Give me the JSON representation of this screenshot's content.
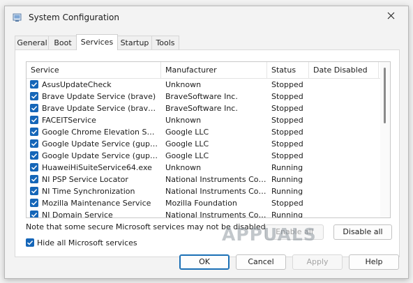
{
  "window": {
    "title": "System Configuration",
    "app_icon": "msconfig-icon",
    "close_icon": "close-icon"
  },
  "tabs": [
    {
      "label": "General",
      "active": false
    },
    {
      "label": "Boot",
      "active": false
    },
    {
      "label": "Services",
      "active": true
    },
    {
      "label": "Startup",
      "active": false
    },
    {
      "label": "Tools",
      "active": false
    }
  ],
  "services_table": {
    "columns": [
      "Service",
      "Manufacturer",
      "Status",
      "Date Disabled"
    ],
    "rows": [
      {
        "checked": true,
        "service": "AsusUpdateCheck",
        "manufacturer": "Unknown",
        "status": "Stopped",
        "date_disabled": ""
      },
      {
        "checked": true,
        "service": "Brave Update Service (brave)",
        "manufacturer": "BraveSoftware Inc.",
        "status": "Stopped",
        "date_disabled": ""
      },
      {
        "checked": true,
        "service": "Brave Update Service (bravem)",
        "manufacturer": "BraveSoftware Inc.",
        "status": "Stopped",
        "date_disabled": ""
      },
      {
        "checked": true,
        "service": "FACEITService",
        "manufacturer": "Unknown",
        "status": "Stopped",
        "date_disabled": ""
      },
      {
        "checked": true,
        "service": "Google Chrome Elevation Servic...",
        "manufacturer": "Google LLC",
        "status": "Stopped",
        "date_disabled": ""
      },
      {
        "checked": true,
        "service": "Google Update Service (gupdate)",
        "manufacturer": "Google LLC",
        "status": "Stopped",
        "date_disabled": ""
      },
      {
        "checked": true,
        "service": "Google Update Service (gupdatem)",
        "manufacturer": "Google LLC",
        "status": "Stopped",
        "date_disabled": ""
      },
      {
        "checked": true,
        "service": "HuaweiHiSuiteService64.exe",
        "manufacturer": "Unknown",
        "status": "Running",
        "date_disabled": ""
      },
      {
        "checked": true,
        "service": "NI PSP Service Locator",
        "manufacturer": "National Instruments Corp...",
        "status": "Running",
        "date_disabled": ""
      },
      {
        "checked": true,
        "service": "NI Time Synchronization",
        "manufacturer": "National Instruments Corp...",
        "status": "Running",
        "date_disabled": ""
      },
      {
        "checked": true,
        "service": "Mozilla Maintenance Service",
        "manufacturer": "Mozilla Foundation",
        "status": "Stopped",
        "date_disabled": ""
      },
      {
        "checked": true,
        "service": "NI Domain Service",
        "manufacturer": "National Instruments Corp...",
        "status": "Running",
        "date_disabled": ""
      }
    ]
  },
  "note": "Note that some secure Microsoft services may not be disabled.",
  "enable_all_label": "Enable all",
  "disable_all_label": "Disable all",
  "hide_ms_services": {
    "label": "Hide all Microsoft services",
    "checked": true
  },
  "footer": {
    "ok_label": "OK",
    "cancel_label": "Cancel",
    "apply_label": "Apply",
    "help_label": "Help"
  },
  "watermark_text": "APPUALS",
  "colors": {
    "accent": "#1566b8",
    "disabled_text": "#a4a4a4"
  }
}
